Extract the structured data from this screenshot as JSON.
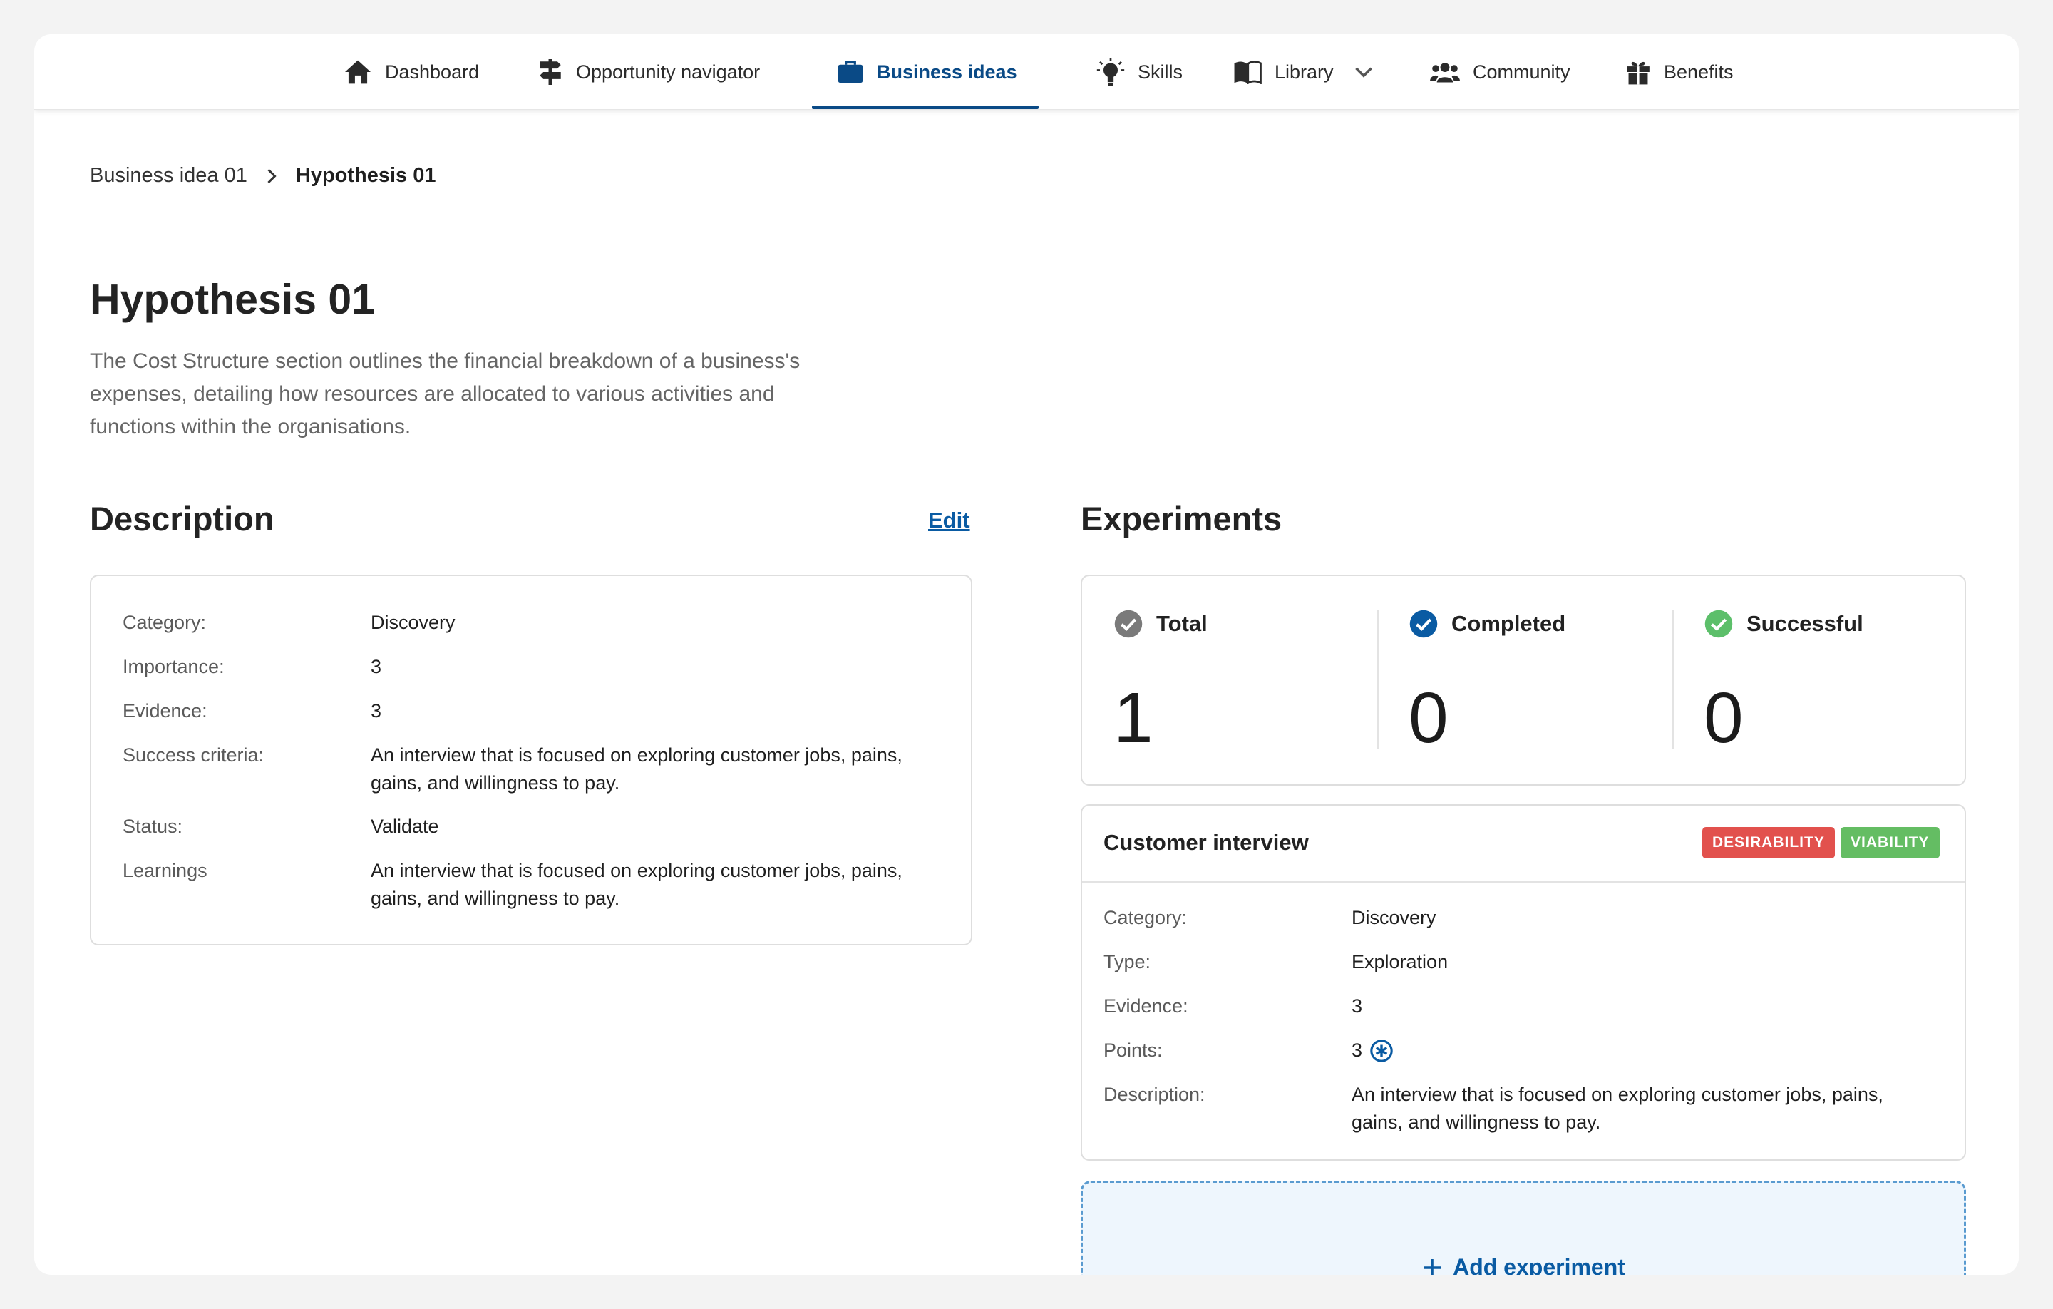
{
  "nav": {
    "items": [
      {
        "label": "Dashboard",
        "icon": "home-icon"
      },
      {
        "label": "Opportunity navigator",
        "icon": "signpost-icon"
      },
      {
        "label": "Business ideas",
        "icon": "briefcase-icon",
        "active": true
      },
      {
        "label": "Skills",
        "icon": "lightbulb-icon"
      },
      {
        "label": "Library",
        "icon": "book-icon"
      },
      {
        "label": "Community",
        "icon": "users-icon"
      },
      {
        "label": "Benefits",
        "icon": "gift-icon"
      }
    ]
  },
  "breadcrumb": {
    "parent": "Business idea 01",
    "current": "Hypothesis 01"
  },
  "page": {
    "title": "Hypothesis 01",
    "subtitle": "The Cost Structure section outlines the financial breakdown of a business's expenses, detailing how resources are allocated to various activities and functions within the organisations."
  },
  "description": {
    "heading": "Description",
    "edit_label": "Edit",
    "rows": [
      {
        "key": "Category:",
        "value": "Discovery"
      },
      {
        "key": "Importance:",
        "value": "3"
      },
      {
        "key": "Evidence:",
        "value": "3"
      },
      {
        "key": "Success criteria:",
        "value": "An interview that is focused on exploring customer jobs, pains, gains, and willingness to pay."
      },
      {
        "key": "Status:",
        "value": "Validate"
      },
      {
        "key": "Learnings",
        "value": "An interview that is focused on exploring customer jobs, pains, gains, and willingness to pay."
      }
    ]
  },
  "experiments": {
    "heading": "Experiments",
    "stats": [
      {
        "label": "Total",
        "value": "1",
        "color": "#7a7a7a"
      },
      {
        "label": "Completed",
        "value": "0",
        "color": "#0a5ba3"
      },
      {
        "label": "Successful",
        "value": "0",
        "color": "#5cbf6a"
      }
    ],
    "card": {
      "title": "Customer interview",
      "badges": [
        {
          "label": "DESIRABILITY",
          "color": "#e2514d"
        },
        {
          "label": "VIABILITY",
          "color": "#64bd63"
        }
      ],
      "rows": [
        {
          "key": "Category:",
          "value": "Discovery"
        },
        {
          "key": "Type:",
          "value": "Exploration"
        },
        {
          "key": "Evidence:",
          "value": "3"
        },
        {
          "key": "Points:",
          "value": "3"
        },
        {
          "key": "Description:",
          "value": "An interview that is focused on exploring customer jobs, pains, gains, and willingness to pay."
        }
      ]
    },
    "add_label": "Add experiment"
  },
  "colors": {
    "accent": "#0a4a86",
    "link": "#0a5ba3"
  }
}
